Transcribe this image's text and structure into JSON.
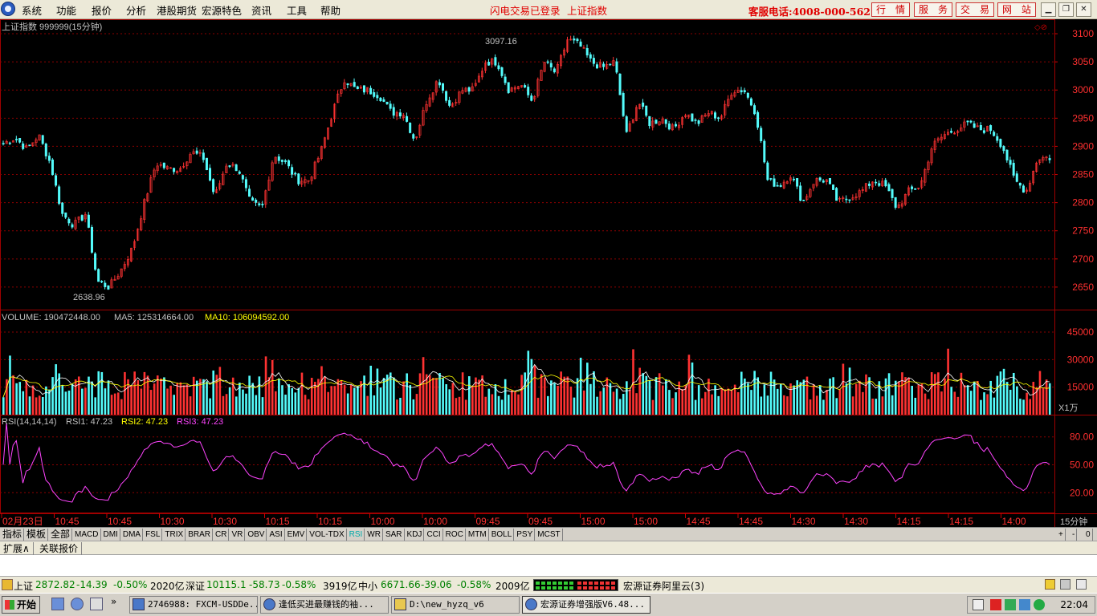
{
  "menu": {
    "items": [
      "系统",
      "功能",
      "报价",
      "分析",
      "港股期货",
      "宏源特色",
      "资讯",
      "工具",
      "帮助"
    ],
    "notice1": "闪电交易已登录",
    "notice2": "上证指数",
    "hotline": "客服电话:4008-000-562",
    "buttons": [
      "行　情",
      "服　务",
      "交　易",
      "网　站"
    ]
  },
  "main_chart": {
    "title": "上证指数 999999(15分钟)",
    "high_label": "3097.16",
    "low_label": "2638.96",
    "y_ticks": [
      3100,
      3050,
      3000,
      2950,
      2900,
      2850,
      2800,
      2750,
      2700,
      2650
    ],
    "ylim": [
      2610,
      3120
    ]
  },
  "volume_chart": {
    "label_volume": "VOLUME: 190472448.00",
    "label_ma5": "MA5: 125314664.00",
    "label_ma10": "MA10: 106094592.00",
    "y_ticks": [
      "45000",
      "30000",
      "15000"
    ],
    "unit": "X1万"
  },
  "rsi_chart": {
    "label_params": "RSI(14,14,14)",
    "label_rsi1": "RSI1: 47.23",
    "label_rsi2": "RSI2: 47.23",
    "label_rsi3": "RSI3: 47.23",
    "y_ticks": [
      "80.00",
      "50.00",
      "20.00"
    ]
  },
  "x_axis": {
    "labels": [
      "02月23日",
      "10:45",
      "10:45",
      "10:30",
      "10:30",
      "10:15",
      "10:15",
      "10:00",
      "10:00",
      "09:45",
      "09:45",
      "15:00",
      "15:00",
      "14:45",
      "14:45",
      "14:30",
      "14:30",
      "14:15",
      "14:15",
      "14:00"
    ],
    "period": "15分钟"
  },
  "chart_data": {
    "type": "candlestick",
    "title": "上证指数 999999(15分钟)",
    "series_close_waypoints": [
      2905,
      2915,
      2895,
      2920,
      2870,
      2780,
      2760,
      2780,
      2660,
      2650,
      2680,
      2720,
      2800,
      2870,
      2860,
      2860,
      2890,
      2880,
      2810,
      2870,
      2860,
      2800,
      2790,
      2885,
      2870,
      2840,
      2840,
      2890,
      2960,
      3020,
      3000,
      3000,
      2990,
      2960,
      2960,
      2910,
      2980,
      3020,
      2970,
      3000,
      3000,
      3050,
      3050,
      3000,
      3010,
      2980,
      3050,
      3030,
      3090,
      3080,
      3050,
      3040,
      3050,
      2920,
      2980,
      2940,
      2950,
      2930,
      2960,
      2940,
      2960,
      2950,
      3000,
      3000,
      2960,
      2840,
      2830,
      2850,
      2800,
      2840,
      2840,
      2800,
      2810,
      2820,
      2840,
      2830,
      2790,
      2820,
      2830,
      2900,
      2920,
      2930,
      2940,
      2930,
      2930,
      2900,
      2840,
      2820,
      2880,
      2880
    ],
    "high": 3097.16,
    "low": 2638.96,
    "volume_ticks": [
      45000,
      30000,
      15000
    ],
    "rsi_ticks": [
      80,
      50,
      20
    ]
  },
  "tabs": [
    "指标",
    "模板",
    "全部",
    "MACD",
    "DMI",
    "DMA",
    "FSL",
    "TRIX",
    "BRAR",
    "CR",
    "VR",
    "OBV",
    "ASI",
    "EMV",
    "VOL-TDX",
    "RSI",
    "WR",
    "SAR",
    "KDJ",
    "CCI",
    "ROC",
    "MTM",
    "BOLL",
    "PSY",
    "MCST"
  ],
  "tab_right": [
    "+",
    "-",
    "0"
  ],
  "ext_tabs": [
    "扩展∧",
    "关联报价"
  ],
  "status": {
    "sh_name": "上证",
    "sh_value": "2872.82",
    "sh_change": "-14.39",
    "sh_pct": "-0.50%",
    "sh_amount": "2020亿",
    "sz_name": "深证",
    "sz_value": "10115.1",
    "sz_change": "-58.73",
    "sz_pct": "-0.58%",
    "sz_amount": "3919亿",
    "zx_name": "中小",
    "zx_value": "6671.66",
    "zx_change": "-39.06",
    "zx_pct": "-0.58%",
    "zx_amount": "2009亿",
    "server": "宏源证券阿里云(3)"
  },
  "taskbar": {
    "start": "开始",
    "items": [
      "2746988: FXCM-USDDe...",
      "逢低买进最赚钱的袖...",
      "D:\\new_hyzq_v6",
      "宏源证券增强版V6.48..."
    ],
    "clock": "22:04"
  },
  "colors": {
    "up": "#ff3232",
    "down": "#54fcfc",
    "ma5": "#ffffff",
    "ma10": "#ffff00",
    "rsi": "#ff44ff",
    "grid": "#8b0000"
  }
}
